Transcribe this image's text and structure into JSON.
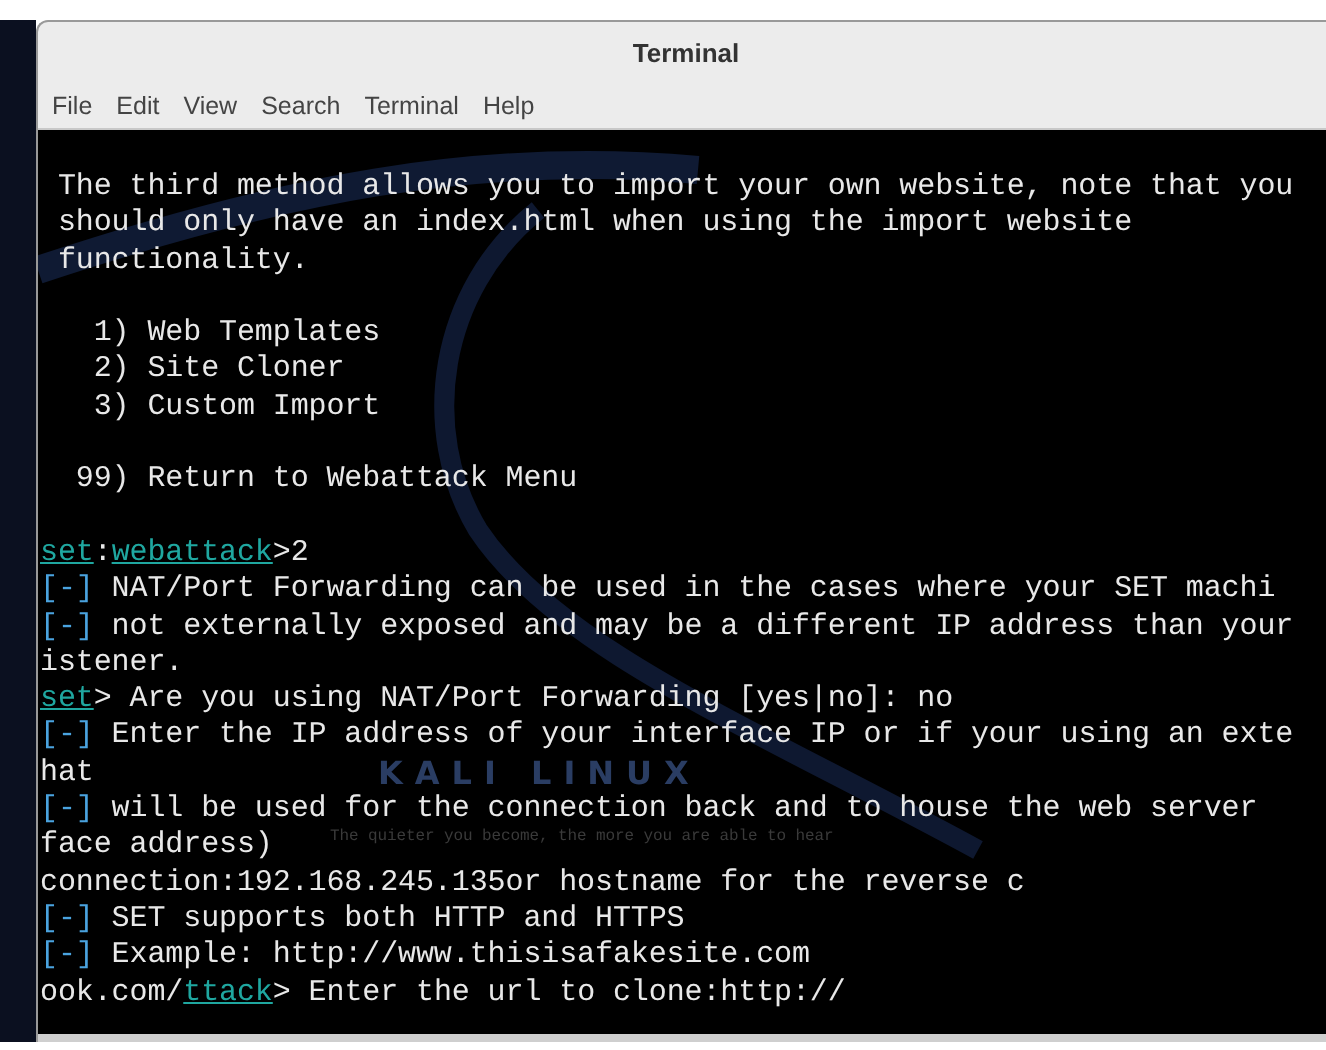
{
  "window": {
    "title": "Terminal"
  },
  "menu": [
    {
      "label": "File"
    },
    {
      "label": "Edit"
    },
    {
      "label": "View"
    },
    {
      "label": "Search"
    },
    {
      "label": "Terminal"
    },
    {
      "label": "Help"
    }
  ],
  "wallpaper": {
    "logo_text": "KALI LINUX",
    "tagline": "The quieter you become, the more you are able to hear"
  },
  "terminal": {
    "lines": [
      {
        "gap_before": false,
        "segments": [
          {
            "kind": "text",
            "text": " The third method allows you to import your own website, note that you"
          }
        ]
      },
      {
        "gap_before": false,
        "segments": [
          {
            "kind": "text",
            "text": " should only have an index.html when using the import website"
          }
        ]
      },
      {
        "gap_before": false,
        "segments": [
          {
            "kind": "text",
            "text": " functionality."
          }
        ]
      },
      {
        "gap_before": true,
        "segments": [
          {
            "kind": "text",
            "text": "   1) Web Templates"
          }
        ]
      },
      {
        "gap_before": false,
        "segments": [
          {
            "kind": "text",
            "text": "   2) Site Cloner"
          }
        ]
      },
      {
        "gap_before": false,
        "segments": [
          {
            "kind": "text",
            "text": "   3) Custom Import"
          }
        ]
      },
      {
        "gap_before": true,
        "segments": [
          {
            "kind": "text",
            "text": "  99) Return to Webattack Menu"
          }
        ]
      },
      {
        "gap_before": true,
        "segments": [
          {
            "kind": "link",
            "text": "set"
          },
          {
            "kind": "text",
            "text": ":"
          },
          {
            "kind": "link",
            "text": "webattack"
          },
          {
            "kind": "text",
            "text": ">2"
          }
        ]
      },
      {
        "gap_before": false,
        "segments": [
          {
            "kind": "marker",
            "text": "[-]"
          },
          {
            "kind": "text",
            "text": " NAT/Port Forwarding can be used in the cases where your SET machi"
          }
        ]
      },
      {
        "gap_before": false,
        "segments": [
          {
            "kind": "marker",
            "text": "[-]"
          },
          {
            "kind": "text",
            "text": " not externally exposed and may be a different IP address than your"
          }
        ]
      },
      {
        "gap_before": false,
        "segments": [
          {
            "kind": "text",
            "text": "istener."
          }
        ]
      },
      {
        "gap_before": false,
        "segments": [
          {
            "kind": "link",
            "text": "set"
          },
          {
            "kind": "text",
            "text": "> Are you using NAT/Port Forwarding [yes|no]: no"
          }
        ]
      },
      {
        "gap_before": false,
        "segments": [
          {
            "kind": "marker",
            "text": "[-]"
          },
          {
            "kind": "text",
            "text": " Enter the IP address of your interface IP or if your using an exte"
          }
        ]
      },
      {
        "gap_before": false,
        "segments": [
          {
            "kind": "text",
            "text": "hat"
          }
        ]
      },
      {
        "gap_before": false,
        "segments": [
          {
            "kind": "marker",
            "text": "[-]"
          },
          {
            "kind": "text",
            "text": " will be used for the connection back and to house the web server"
          }
        ]
      },
      {
        "gap_before": false,
        "segments": [
          {
            "kind": "text",
            "text": "face address)"
          }
        ]
      },
      {
        "gap_before": false,
        "segments": [
          {
            "kind": "text",
            "text": "connection:192.168.245.135or hostname for the reverse c"
          }
        ]
      },
      {
        "gap_before": false,
        "segments": [
          {
            "kind": "marker",
            "text": "[-]"
          },
          {
            "kind": "text",
            "text": " SET supports both HTTP and HTTPS"
          }
        ]
      },
      {
        "gap_before": false,
        "segments": [
          {
            "kind": "marker",
            "text": "[-]"
          },
          {
            "kind": "text",
            "text": " Example: http://www.thisisafakesite.com"
          }
        ]
      },
      {
        "gap_before": false,
        "segments": [
          {
            "kind": "text",
            "text": "ook.com/"
          },
          {
            "kind": "link",
            "text": "ttack"
          },
          {
            "kind": "text",
            "text": "> Enter the url to clone:http://"
          }
        ]
      }
    ]
  }
}
